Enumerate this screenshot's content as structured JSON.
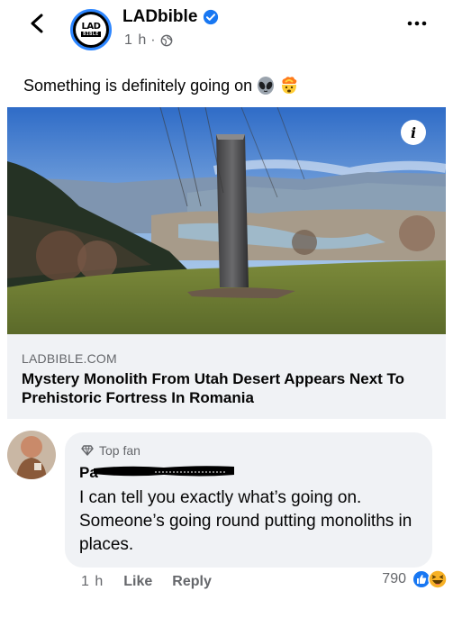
{
  "post": {
    "page_name": "LADbible",
    "logo_top": "LAD",
    "logo_bottom": "BIBLE",
    "time": "1 h",
    "separator": "·",
    "caption": "Something is definitely going on"
  },
  "link_card": {
    "domain": "LADBIBLE.COM",
    "headline": "Mystery Monolith From Utah Desert Appears Next To Prehistoric Fortress In Romania",
    "info_icon": "i"
  },
  "comment": {
    "badge": "Top fan",
    "author_visible": "Pa",
    "text": "I can tell you exactly what’s going on. Someone’s going round putting monoliths in places.",
    "time": "1 h",
    "like_label": "Like",
    "reply_label": "Reply",
    "reaction_count": "790"
  },
  "icons": {
    "back": "chevron-left-icon",
    "verified": "verified-badge-icon",
    "globe": "globe-icon",
    "more": "more-dots-icon",
    "alien": "alien-emoji",
    "mind_blown": "mind-blown-emoji",
    "like": "like-reaction-icon",
    "haha": "haha-reaction-icon"
  },
  "colors": {
    "accent": "#1877f2",
    "secondary_text": "#65676b",
    "card_bg": "#f0f2f5"
  }
}
